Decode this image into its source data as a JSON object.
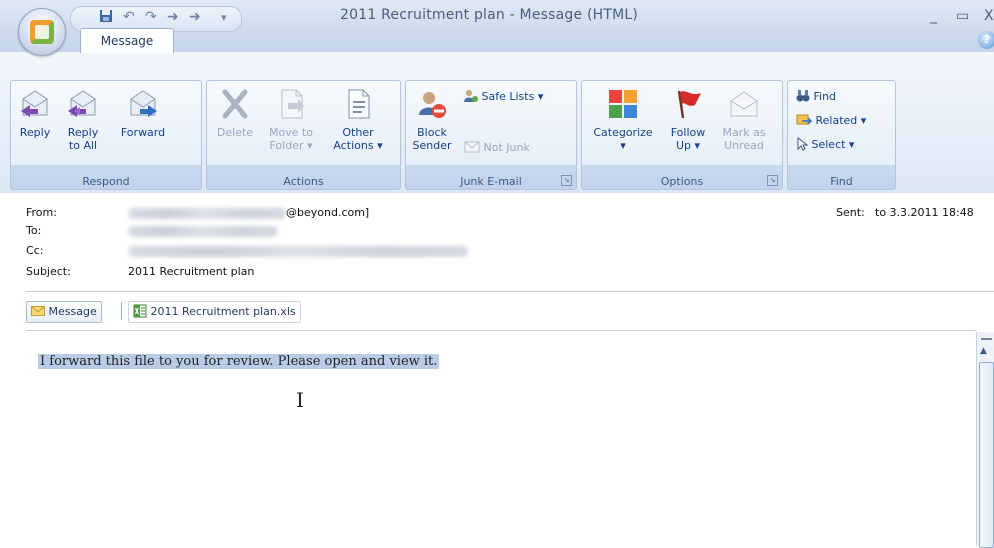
{
  "window": {
    "title": "2011 Recruitment plan - Message (HTML)",
    "controls": {
      "minimize": "_",
      "maximize": "▭",
      "close": "X"
    }
  },
  "tabs": [
    {
      "label": "Message",
      "selected": true
    }
  ],
  "ribbon": {
    "groups": {
      "respond": {
        "label": "Respond"
      },
      "actions": {
        "label": "Actions"
      },
      "junk": {
        "label": "Junk E-mail"
      },
      "options": {
        "label": "Options"
      },
      "find": {
        "label": "Find"
      }
    },
    "reply": "Reply",
    "reply_all_1": "Reply",
    "reply_all_2": "to All",
    "forward": "Forward",
    "delete": "Delete",
    "move_1": "Move to",
    "move_2": "Folder ▾",
    "other_1": "Other",
    "other_2": "Actions ▾",
    "block_1": "Block",
    "block_2": "Sender",
    "safe_lists": "Safe Lists ▾",
    "not_junk": "Not Junk",
    "categorize": "Categorize",
    "categorize_arrow": "▾",
    "follow_1": "Follow",
    "follow_2": "Up ▾",
    "mark_1": "Mark as",
    "mark_2": "Unread",
    "find": "Find",
    "related": "Related ▾",
    "select": "Select ▾"
  },
  "header": {
    "from_label": "From:",
    "from_value": "@beyond.com]",
    "to_label": "To:",
    "cc_label": "Cc:",
    "subject_label": "Subject:",
    "subject_value": "2011 Recruitment plan",
    "sent_label": "Sent:",
    "sent_value": "to 3.3.2011 18:48"
  },
  "attachments": {
    "message_tab": "Message",
    "file": "2011 Recruitment plan.xls"
  },
  "body": {
    "text": "I forward this file to you for review. Please open and view it."
  },
  "colors": {
    "ribbon_text": "#15428b",
    "selection": "#b9cbe6",
    "chrome_blue": "#dfe9f5"
  }
}
